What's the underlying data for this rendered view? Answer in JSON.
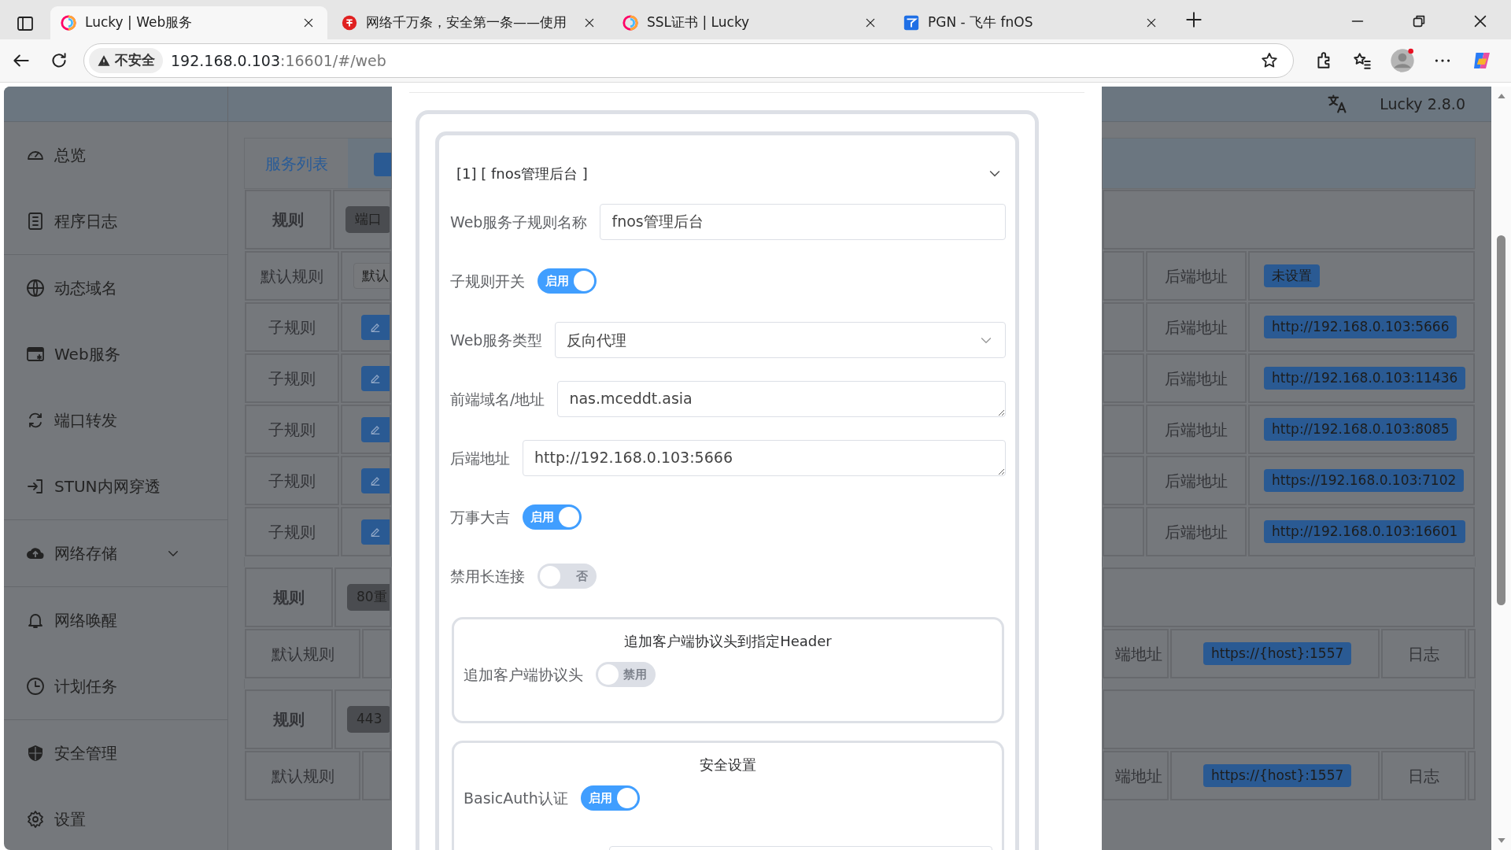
{
  "browser": {
    "tabs": [
      {
        "title": "Lucky | Web服务",
        "selected": true
      },
      {
        "title": "网络千万条，安全第一条——使用",
        "selected": false
      },
      {
        "title": "SSL证书 | Lucky",
        "selected": false
      },
      {
        "title": "PGN - 飞牛 fnOS",
        "selected": false
      }
    ],
    "address": {
      "security": "不安全",
      "host": "192.168.0.103",
      "path": ":16601/#/web"
    }
  },
  "header": {
    "version": "Lucky 2.8.0"
  },
  "sidebar": {
    "groups": [
      {
        "items": [
          {
            "label": "总览"
          },
          {
            "label": "程序日志"
          }
        ]
      },
      {
        "items": [
          {
            "label": "动态域名"
          },
          {
            "label": "Web服务"
          },
          {
            "label": "端口转发"
          },
          {
            "label": "STUN内网穿透"
          }
        ]
      },
      {
        "items": [
          {
            "label": "网络存储",
            "expanded": false
          }
        ]
      },
      {
        "items": [
          {
            "label": "网络唤醒"
          },
          {
            "label": "计划任务"
          }
        ]
      },
      {
        "items": [
          {
            "label": "安全管理"
          },
          {
            "label": "设置"
          }
        ]
      }
    ]
  },
  "tabs": [
    {
      "label": "服务列表",
      "selected": true
    }
  ],
  "rules": [
    {
      "label": "规则",
      "tag": "端口",
      "rows": [
        {
          "kind": "default",
          "label": "默认规则",
          "tag": "默认",
          "backend_label": "后端地址",
          "backend": "未设置"
        },
        {
          "kind": "child",
          "label": "子规则",
          "backend_label": "后端地址",
          "backend": "http://192.168.0.103:5666"
        },
        {
          "kind": "child",
          "label": "子规则",
          "backend_label": "后端地址",
          "backend": "http://192.168.0.103:11436"
        },
        {
          "kind": "child",
          "label": "子规则",
          "backend_label": "后端地址",
          "backend": "http://192.168.0.103:8085"
        },
        {
          "kind": "child",
          "label": "子规则",
          "backend_label": "后端地址",
          "backend": "https://192.168.0.103:7102"
        },
        {
          "kind": "child",
          "label": "子规则",
          "backend_label": "后端地址",
          "backend": "http://192.168.0.103:16601"
        }
      ]
    },
    {
      "label": "规则",
      "tag": "80重",
      "rows": [
        {
          "kind": "default",
          "label": "默认规则",
          "backend_label": "端地址",
          "backend": "https://{host}:1557",
          "log": "日志"
        }
      ]
    },
    {
      "label": "规则",
      "tag": "443",
      "rows": [
        {
          "kind": "default",
          "label": "默认规则",
          "backend_label": "端地址",
          "backend": "https://{host}:1557",
          "log": "日志"
        }
      ]
    }
  ],
  "dialog": {
    "title": "[1] [ fnos管理后台 ]",
    "fields": [
      {
        "kind": "input",
        "label": "Web服务子规则名称",
        "value": "fnos管理后台"
      },
      {
        "kind": "switch",
        "label": "子规则开关",
        "on": true,
        "text": "启用"
      },
      {
        "kind": "select",
        "label": "Web服务类型",
        "value": "反向代理"
      },
      {
        "kind": "textarea",
        "label": "前端域名/地址",
        "value": "nas.mceddt.asia"
      },
      {
        "kind": "textarea",
        "label": "后端地址",
        "value": "http://192.168.0.103:5666"
      },
      {
        "kind": "switch",
        "label": "万事大吉",
        "on": true,
        "text": "启用"
      },
      {
        "kind": "switch",
        "label": "禁用长连接",
        "on": false,
        "text": "否"
      }
    ],
    "sections": [
      {
        "title": "追加客户端协议头到指定Header",
        "fields": [
          {
            "kind": "switch",
            "label": "追加客户端协议头",
            "on": false,
            "text": "禁用"
          }
        ]
      },
      {
        "title": "安全设置",
        "fields": [
          {
            "kind": "switch",
            "label": "BasicAuth认证",
            "on": true,
            "text": "启用"
          },
          {
            "kind": "input"
          }
        ]
      }
    ]
  }
}
